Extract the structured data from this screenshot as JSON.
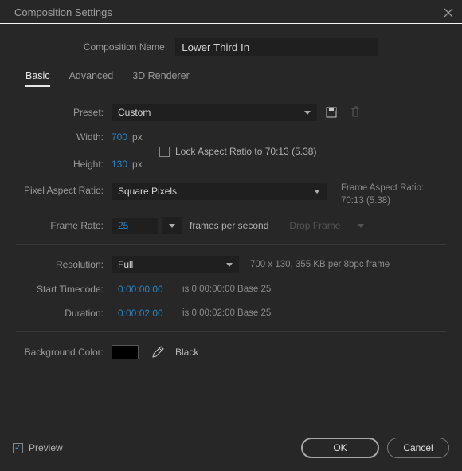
{
  "title": "Composition Settings",
  "compName": {
    "label": "Composition Name:",
    "value": "Lower Third In"
  },
  "tabs": {
    "basic": "Basic",
    "advanced": "Advanced",
    "renderer": "3D Renderer"
  },
  "preset": {
    "label": "Preset:",
    "value": "Custom"
  },
  "width": {
    "label": "Width:",
    "value": "700",
    "unit": "px"
  },
  "height": {
    "label": "Height:",
    "value": "130",
    "unit": "px"
  },
  "lockAR": {
    "label": "Lock Aspect Ratio to 70:13 (5.38)"
  },
  "par": {
    "label": "Pixel Aspect Ratio:",
    "value": "Square Pixels"
  },
  "farNote": {
    "label": "Frame Aspect Ratio:",
    "value": "70:13 (5.38)"
  },
  "fps": {
    "label": "Frame Rate:",
    "value": "25",
    "unit": "frames per second",
    "dropFrame": "Drop Frame"
  },
  "res": {
    "label": "Resolution:",
    "value": "Full",
    "note": "700 x 130, 355 KB per 8bpc frame"
  },
  "start": {
    "label": "Start Timecode:",
    "value": "0:00:00:00",
    "note": "is 0:00:00:00  Base 25"
  },
  "dur": {
    "label": "Duration:",
    "value": "0:00:02:00",
    "note": "is 0:00:02:00  Base 25"
  },
  "bg": {
    "label": "Background Color:",
    "colorName": "Black"
  },
  "footer": {
    "preview": "Preview",
    "ok": "OK",
    "cancel": "Cancel"
  }
}
